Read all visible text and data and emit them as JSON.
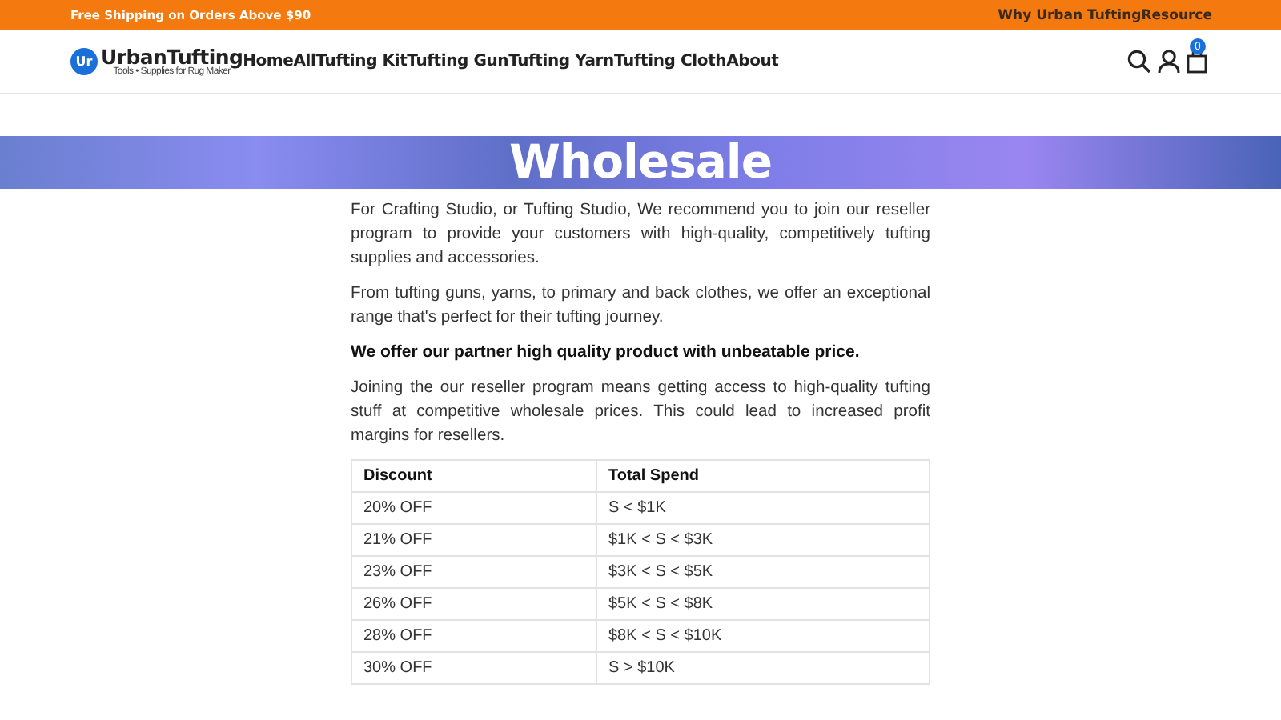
{
  "announcement": {
    "text": "Free Shipping on Orders Above $90",
    "links": [
      "Why Urban Tufting",
      "Resource"
    ]
  },
  "header": {
    "logo": {
      "badge": "Ur",
      "name": "UrbanTufting",
      "tagline": "Tools • Supplies for Rug Maker"
    },
    "nav": [
      "Home",
      "All",
      "Tufting Kit",
      "Tufting Gun",
      "Tufting Yarn",
      "Tufting Cloth",
      "About"
    ],
    "cart_count": "0"
  },
  "banner": {
    "title": "Wholesale"
  },
  "paragraphs": [
    {
      "text": "For Crafting Studio, or Tufting Studio, We recommend you to join our reseller program to provide your customers with high-quality, competitively tufting supplies and accessories.",
      "bold": false
    },
    {
      "text": "From tufting guns, yarns, to primary and back clothes, we offer an exceptional range that's perfect for their tufting journey.",
      "bold": false
    },
    {
      "text": "We offer our partner high quality product with unbeatable price.",
      "bold": true
    },
    {
      "text": "Joining the our reseller program means getting access to high-quality tufting stuff at competitive wholesale prices. This could lead to increased profit margins for resellers.",
      "bold": false
    }
  ],
  "table": {
    "columns": [
      "Discount",
      "Total Spend"
    ],
    "rows": [
      [
        "20% OFF",
        "S < $1K"
      ],
      [
        "21% OFF",
        "$1K < S < $3K"
      ],
      [
        "23% OFF",
        "$3K < S < $5K"
      ],
      [
        "26% OFF",
        "$5K < S < $8K"
      ],
      [
        "28% OFF",
        "$8K < S < $10K"
      ],
      [
        "30% OFF",
        "S > $10K"
      ]
    ]
  }
}
